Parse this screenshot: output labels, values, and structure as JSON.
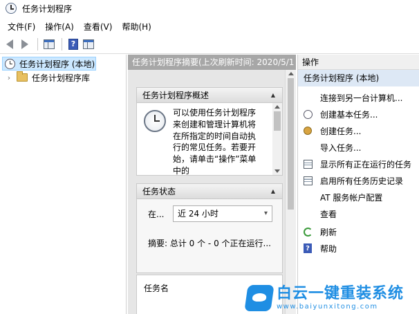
{
  "window": {
    "title": "任务计划程序"
  },
  "menu": [
    {
      "label": "文件(F)"
    },
    {
      "label": "操作(A)"
    },
    {
      "label": "查看(V)"
    },
    {
      "label": "帮助(H)"
    }
  ],
  "tree": {
    "root_label": "任务计划程序 (本地)",
    "library_label": "任务计划程序库"
  },
  "middle": {
    "header": "任务计划程序摘要(上次刷新时间: 2020/5/1",
    "overview": {
      "title": "任务计划程序概述",
      "text": "可以使用任务计划程序来创建和管理计算机将在所指定的时间自动执行的常见任务。若要开始，请单击“操作”菜单中的"
    },
    "status": {
      "title": "任务状态",
      "label": "在...",
      "selected_value": "近 24 小时",
      "summary": "摘要: 总计 0 个 - 0 个正在运行..."
    },
    "task_name_label": "任务名"
  },
  "actions": {
    "header": "操作",
    "subheader": "任务计划程序 (本地)",
    "items": [
      {
        "label": "连接到另一台计算机...",
        "icon": "none"
      },
      {
        "label": "创建基本任务...",
        "icon": "clock-icon"
      },
      {
        "label": "创建任务...",
        "icon": "gear-icon"
      },
      {
        "label": "导入任务...",
        "icon": "none"
      },
      {
        "label": "显示所有正在运行的任务",
        "icon": "list-icon"
      },
      {
        "label": "启用所有任务历史记录",
        "icon": "history-icon"
      },
      {
        "label": "AT 服务帐户配置",
        "icon": "none"
      },
      {
        "label": "查看",
        "icon": "none"
      },
      {
        "label": "刷新",
        "icon": "refresh-icon"
      },
      {
        "label": "帮助",
        "icon": "help-icon"
      }
    ]
  },
  "watermark": {
    "text": "白云一键重装系统",
    "url": "www.baiyunxitong.com"
  }
}
